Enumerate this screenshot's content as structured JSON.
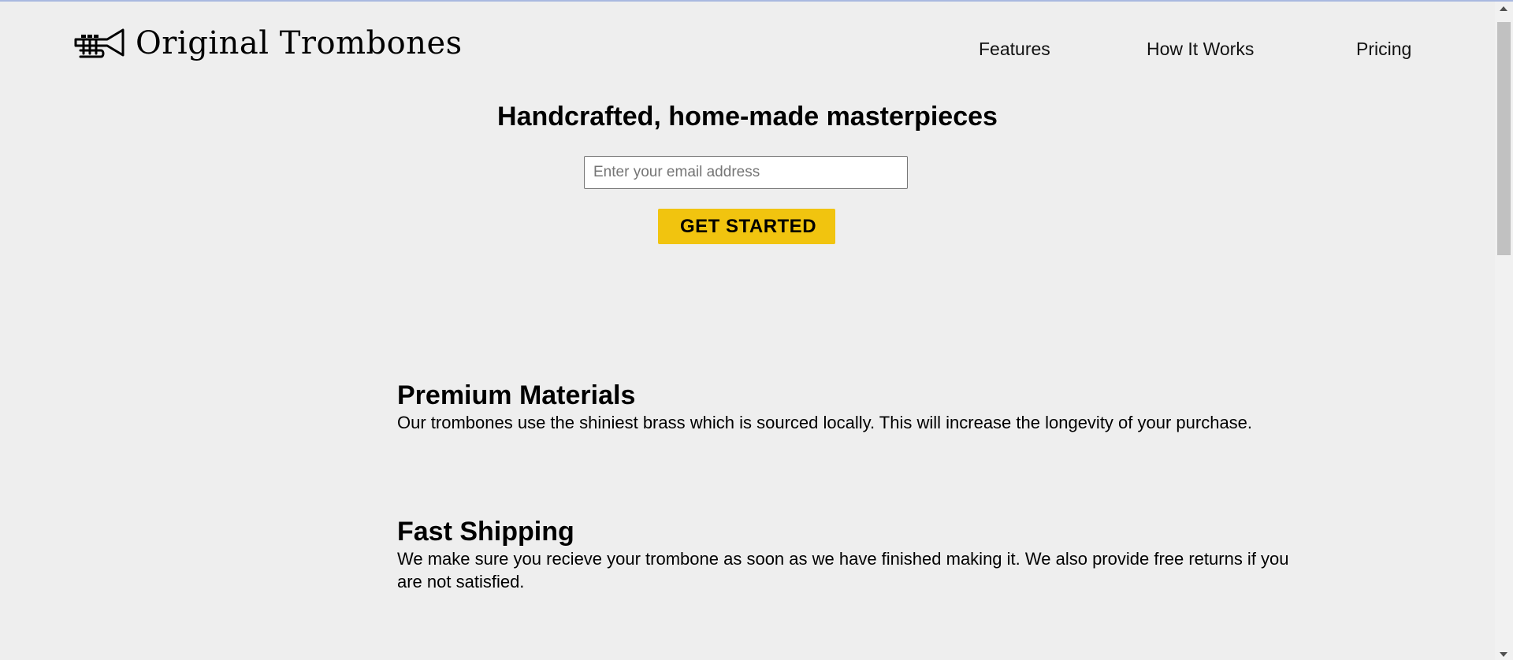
{
  "brand": {
    "logo_icon": "trumpet-icon",
    "name": "Original Trombones"
  },
  "nav": {
    "items": [
      {
        "label": "Features"
      },
      {
        "label": "How It Works"
      },
      {
        "label": "Pricing"
      }
    ]
  },
  "hero": {
    "title": "Handcrafted, home-made masterpieces",
    "email_placeholder": "Enter your email address",
    "cta_label": "GET STARTED",
    "cta_color": "#f1c40f"
  },
  "features": [
    {
      "title": "Premium Materials",
      "text": "Our trombones use the shiniest brass which is sourced locally. This will increase the longevity of your purchase."
    },
    {
      "title": "Fast Shipping",
      "text": "We make sure you recieve your trombone as soon as we have finished making it. We also provide free returns if you are not satisfied."
    }
  ]
}
